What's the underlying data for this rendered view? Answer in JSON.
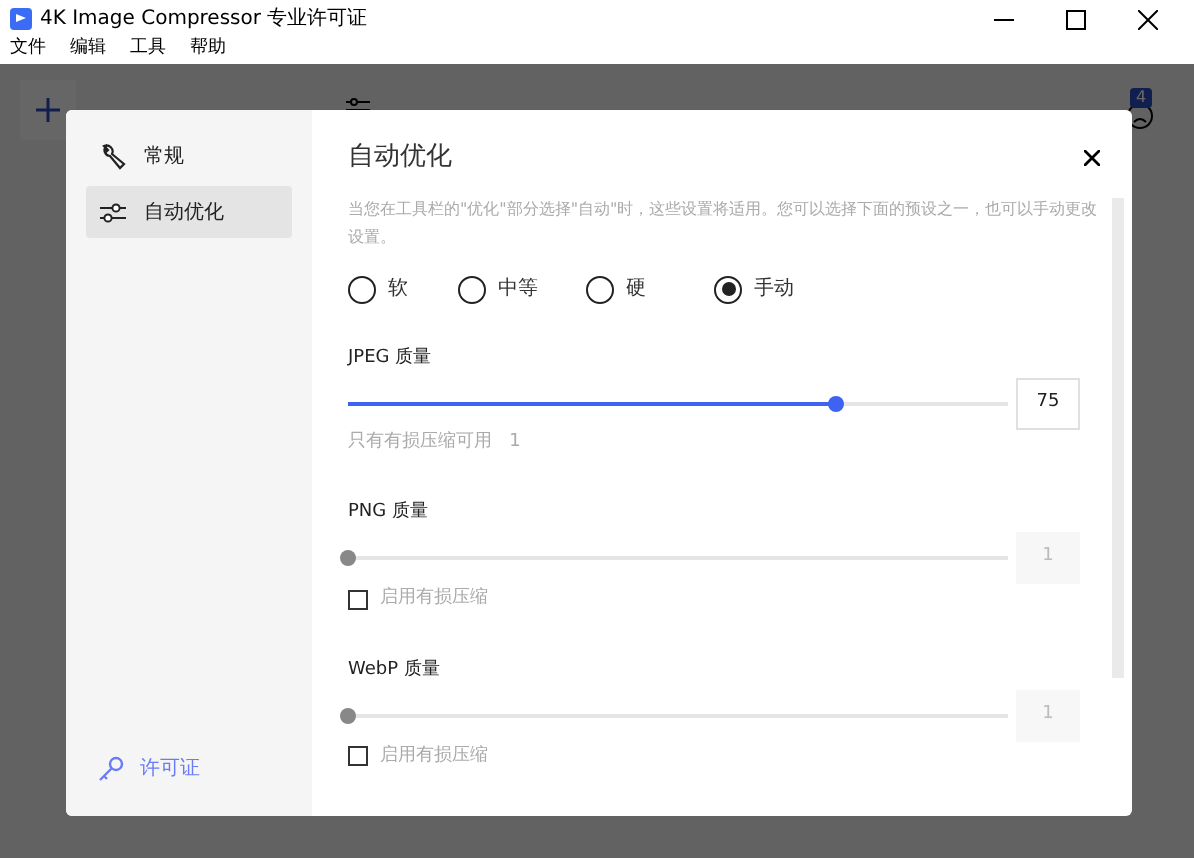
{
  "window": {
    "title": "4K Image Compressor 专业许可证"
  },
  "menu": [
    "文件",
    "编辑",
    "工具",
    "帮助"
  ],
  "toolbar": {
    "badge": "4"
  },
  "dialog": {
    "sidebar": [
      {
        "label": "常规",
        "selected": false
      },
      {
        "label": "自动优化",
        "selected": true
      }
    ],
    "license_link": "许可证",
    "title": "自动优化",
    "description": "当您在工具栏的\"优化\"部分选择\"自动\"时，这些设置将适用。您可以选择下面的预设之一，也可以手动更改设置。",
    "presets": [
      {
        "label": "软",
        "selected": false
      },
      {
        "label": "中等",
        "selected": false
      },
      {
        "label": "硬",
        "selected": false
      },
      {
        "label": "手动",
        "selected": true
      }
    ],
    "sections": [
      {
        "label": "JPEG 质量",
        "level": 0.74,
        "value": "75",
        "disabled": false,
        "note": "只有有损压缩可用   1"
      },
      {
        "label": "PNG 质量",
        "level": 0,
        "value": "1",
        "disabled": true,
        "checkbox": {
          "label": "启用有损压缩",
          "checked": false
        }
      },
      {
        "label": "WebP 质量",
        "level": 0,
        "value": "1",
        "disabled": true,
        "checkbox": {
          "label": "启用有损压缩",
          "checked": false
        }
      }
    ]
  }
}
